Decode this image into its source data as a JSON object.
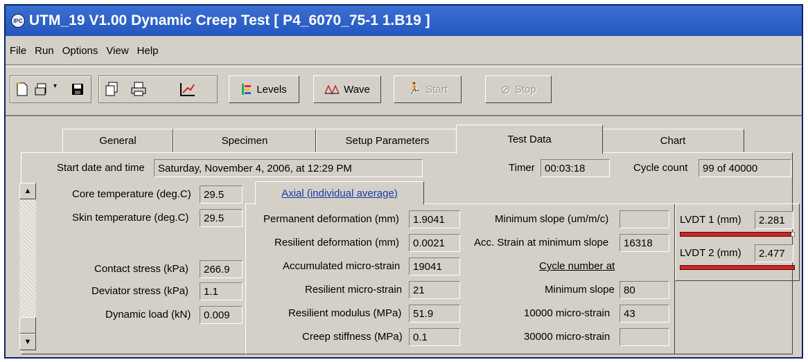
{
  "window": {
    "title": "UTM_19  V1.00 Dynamic Creep Test [ P4_6070_75-1 1.B19 ]",
    "app_icon": "IPC"
  },
  "menu": [
    "File",
    "Run",
    "Options",
    "View",
    "Help"
  ],
  "toolbar": {
    "levels": "Levels",
    "wave": "Wave",
    "start": "Start",
    "stop": "Stop"
  },
  "tabs": [
    "General",
    "Specimen",
    "Setup Parameters",
    "Test Data",
    "Chart"
  ],
  "active_tab": "Test Data",
  "header": {
    "start_label": "Start date and time",
    "start_value": "Saturday, November 4, 2006, at  12:29 PM",
    "timer_label": "Timer",
    "timer_value": "00:03:18",
    "cycle_label": "Cycle count",
    "cycle_value": "99 of 40000"
  },
  "left": {
    "core_temp_label": "Core temperature (deg.C)",
    "core_temp_value": "29.5",
    "skin_temp_label": "Skin temperature (deg.C)",
    "skin_temp_value": "29.5",
    "contact_label": "Contact stress (kPa)",
    "contact_value": "266.9",
    "deviator_label": "Deviator stress (kPa)",
    "deviator_value": "1.1",
    "load_label": "Dynamic load (kN)",
    "load_value": "0.009"
  },
  "axial_tab": "Axial (individual average)",
  "axial": {
    "perm_label": "Permanent deformation (mm)",
    "perm_value": "1.9041",
    "res_def_label": "Resilient deformation (mm)",
    "res_def_value": "0.0021",
    "acc_label": "Accumulated micro-strain",
    "acc_value": "19041",
    "res_ms_label": "Resilient micro-strain",
    "res_ms_value": "21",
    "modulus_label": "Resilient modulus (MPa)",
    "modulus_value": "51.9",
    "creep_label": "Creep stiffness (MPa)",
    "creep_value": "0.1"
  },
  "slope": {
    "min_slope_label": "Minimum slope (um/m/c)",
    "min_slope_value": "",
    "acc_strain_label": "Acc. Strain at minimum slope",
    "acc_strain_value": "16318",
    "cycle_at_label": "Cycle number at",
    "min_label": "Minimum slope",
    "min_value": "80",
    "ms10000_label": "10000 micro-strain",
    "ms10000_value": "43",
    "ms30000_label": "30000 micro-strain",
    "ms30000_value": ""
  },
  "lvdt": {
    "lvdt1_label": "LVDT 1 (mm)",
    "lvdt1_value": "2.281",
    "lvdt1_fill": 0.97,
    "lvdt2_label": "LVDT 2 (mm)",
    "lvdt2_value": "2.477",
    "lvdt2_fill": 1.0
  },
  "colors": {
    "title_bar": "#2457c0",
    "lvdt_bar": "#c8282a",
    "link": "#1a3aa6"
  }
}
